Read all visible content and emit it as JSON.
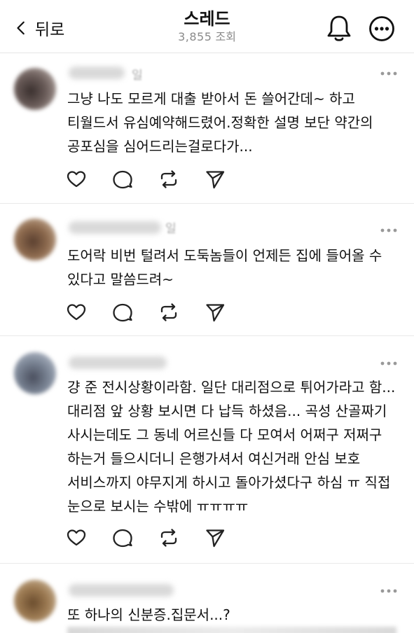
{
  "header": {
    "back_label": "뒤로",
    "title": "스레드",
    "view_count": "3,855",
    "view_unit": "조회"
  },
  "posts": [
    {
      "time": "일",
      "text": "그냥 나도 모르게 대출 받아서 돈 쓸어간데~ 하고 티월드서 유심예약해드렸어.정확한 설명 보단 약간의 공포심을 심어드리는걸로다가...",
      "avatar_color": "#6b5d5a"
    },
    {
      "time": "일",
      "text": "도어락 비번 털려서 도둑놈들이 언제든 집에 들어올 수 있다고 말씀드려~",
      "avatar_color": "#8d6a4e"
    },
    {
      "time": "",
      "text": "걍 준 전시상황이라함. 일단 대리점으로 튀어가라고 함... 대리점 앞 상황 보시면 다 납득 하셨음... 곡성 산골짜기 사시는데도 그 동네 어르신들 다 모여서 어쩌구 저쩌구 하는거 들으시더니 은행가셔서 여신거래 안심 보호 서비스까지 야무지게 하시고 돌아가셨다구 하심 ㅠ 직접 눈으로 보시는 수밖에 ㅠㅠㅠㅠ",
      "avatar_color": "#7a8494"
    },
    {
      "time": "",
      "text": "또 하나의 신분증.집문서...?",
      "avatar_color": "#9c7a52"
    }
  ],
  "icons": {
    "back": "chevron-left-icon",
    "notification": "bell-icon",
    "menu": "more-circle-icon",
    "post_menu": "more-horizontal-icon",
    "like": "heart-icon",
    "reply": "comment-icon",
    "repost": "repost-icon",
    "share": "send-icon"
  }
}
